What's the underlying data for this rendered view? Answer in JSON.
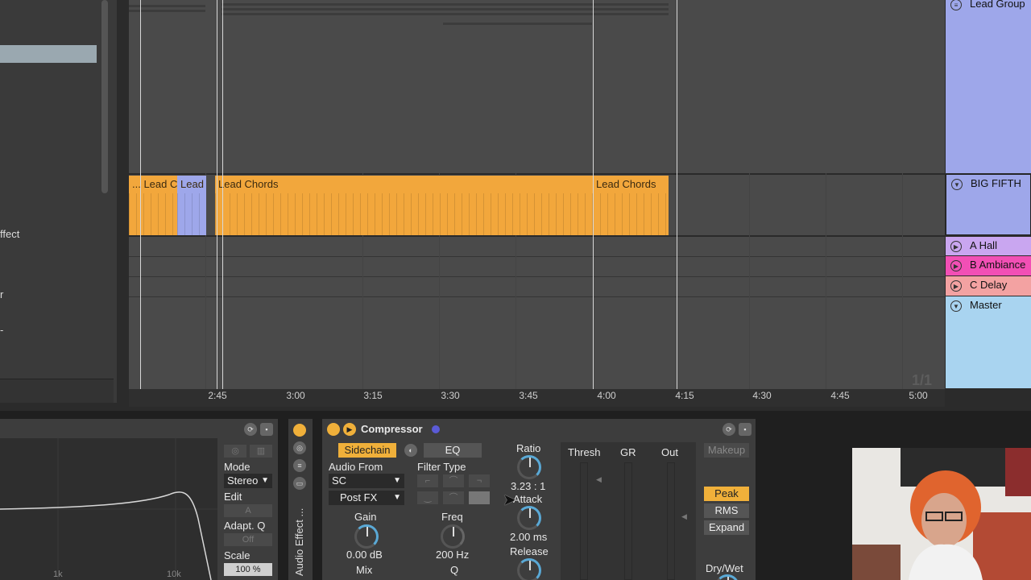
{
  "left_panel": {
    "fragments": [
      "ffect",
      "r",
      "-"
    ]
  },
  "clips": [
    {
      "label": "... Lead C",
      "color": "#f2a73c"
    },
    {
      "label": "Lead",
      "color": "#9ea7ea"
    },
    {
      "label": "Lead Chords",
      "color": "#f2a73c"
    },
    {
      "label": "Lead Chords",
      "color": "#f2a73c"
    }
  ],
  "timeline": {
    "ticks": [
      "2:45",
      "3:00",
      "3:15",
      "3:30",
      "3:45",
      "4:00",
      "4:15",
      "4:30",
      "4:45",
      "5:00"
    ],
    "counter": "1/1"
  },
  "track_headers": [
    {
      "name": "Lead Group",
      "icon": "group-icon",
      "color": "#9ea7ea"
    },
    {
      "name": "BIG FIFTH",
      "icon": "fold-down-icon",
      "color": "#9ea7ea"
    },
    {
      "name": "A Hall",
      "icon": "play-triangle-icon",
      "color": "#c9a6f0"
    },
    {
      "name": "B Ambiance",
      "icon": "play-triangle-icon",
      "color": "#f24fb5"
    },
    {
      "name": "C Delay",
      "icon": "play-triangle-icon",
      "color": "#f3a2a2"
    },
    {
      "name": "Master",
      "icon": "fold-down-icon",
      "color": "#a9d4f0"
    }
  ],
  "eq_device": {
    "mode_label": "Mode",
    "mode_value": "Stereo",
    "edit_label": "Edit",
    "edit_value": "A",
    "adapt_q_label": "Adapt. Q",
    "adapt_q_value": "Off",
    "scale_label": "Scale",
    "scale_value": "100 %",
    "freq_labels": [
      "1k",
      "10k"
    ]
  },
  "side_strip": {
    "label": "Audio Effect ..."
  },
  "compressor": {
    "title": "Compressor",
    "sidechain_label": "Sidechain",
    "eq_label": "EQ",
    "audio_from_label": "Audio From",
    "audio_from_value": "SC",
    "post_fx_value": "Post FX",
    "filter_type_label": "Filter Type",
    "gain_label": "Gain",
    "gain_value": "0.00 dB",
    "mix_label": "Mix",
    "freq_label": "Freq",
    "freq_value": "200 Hz",
    "q_label": "Q",
    "ratio_label": "Ratio",
    "ratio_value": "3.23 : 1",
    "attack_label": "Attack",
    "attack_value": "2.00 ms",
    "release_label": "Release",
    "thresh_label": "Thresh",
    "gr_label": "GR",
    "out_label": "Out",
    "makeup_label": "Makeup",
    "peak_label": "Peak",
    "rms_label": "RMS",
    "expand_label": "Expand",
    "drywet_label": "Dry/Wet"
  },
  "colors": {
    "accent_orange": "#f0b03a",
    "knob_blue": "#5aa9d6",
    "clip_orange": "#f2a73c",
    "clip_blue": "#9ea7ea"
  }
}
